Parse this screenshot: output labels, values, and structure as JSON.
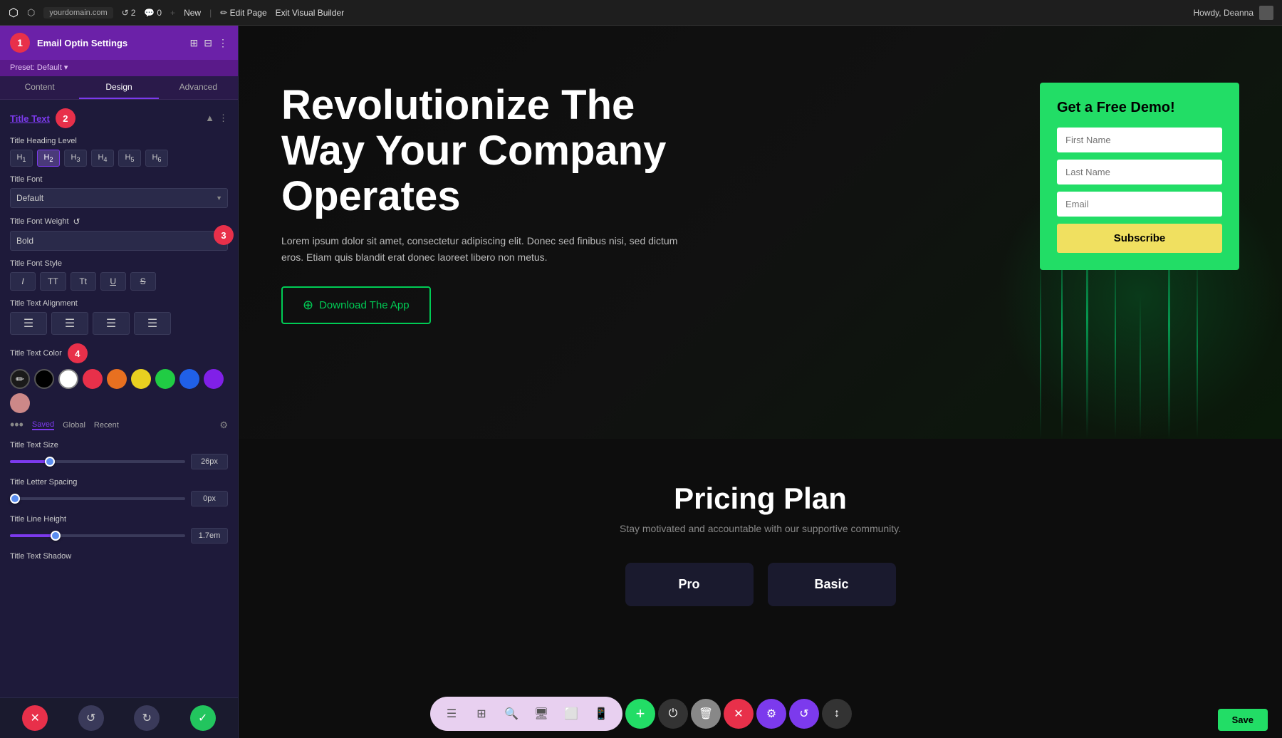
{
  "topbar": {
    "wp_icon": "W",
    "site_icon": "⬡",
    "url": "yourdomain.com",
    "counter_2": "2",
    "counter_0": "0",
    "new_btn": "New",
    "edit_page": "Edit Page",
    "exit_builder": "Exit Visual Builder",
    "howdy": "Howdy, Deanna"
  },
  "left_panel": {
    "title": "Email Optin Settings",
    "preset": "Preset: Default ▾",
    "badge_1": "1",
    "icons": [
      "⊞",
      "⊟",
      "⋮"
    ],
    "tabs": [
      {
        "label": "Content",
        "active": false
      },
      {
        "label": "Design",
        "active": true
      },
      {
        "label": "Advanced",
        "active": false
      }
    ],
    "section": {
      "title": "Title Text",
      "badge": "2",
      "collapse_icon": "▲",
      "more_icon": "⋮"
    },
    "title_heading_level": {
      "label": "Title Heading Level",
      "options": [
        "H₁",
        "H₂",
        "H₃",
        "H₄",
        "H₅",
        "H₆"
      ],
      "active_index": 1
    },
    "title_font": {
      "label": "Title Font",
      "value": "Default"
    },
    "title_font_weight": {
      "label": "Title Font Weight",
      "value": "Bold",
      "badge": "3"
    },
    "title_font_style": {
      "label": "Title Font Style",
      "buttons": [
        "I",
        "TT",
        "Tt",
        "U",
        "S"
      ]
    },
    "title_text_alignment": {
      "label": "Title Text Alignment",
      "buttons": [
        "≡",
        "≡",
        "≡",
        "≡"
      ]
    },
    "title_text_color": {
      "label": "Title Text Color",
      "badge": "4",
      "swatches": [
        {
          "color": "#1a1a1a",
          "type": "pencil"
        },
        {
          "color": "#000000"
        },
        {
          "color": "#ffffff"
        },
        {
          "color": "#e8304a"
        },
        {
          "color": "#e87020"
        },
        {
          "color": "#e8d020"
        },
        {
          "color": "#20cc44"
        },
        {
          "color": "#2060e8"
        },
        {
          "color": "#8020e8"
        },
        {
          "color": "#cc8888"
        }
      ],
      "color_tabs": [
        "Saved",
        "Global",
        "Recent"
      ],
      "active_color_tab": "Saved"
    },
    "title_text_size": {
      "label": "Title Text Size",
      "value": "26px",
      "slider_pct": 22
    },
    "title_letter_spacing": {
      "label": "Title Letter Spacing",
      "value": "0px",
      "slider_pct": 0
    },
    "title_line_height": {
      "label": "Title Line Height",
      "value": "1.7em",
      "slider_pct": 25
    },
    "title_text_shadow": {
      "label": "Title Text Shadow"
    }
  },
  "hero": {
    "title": "Revolutionize The Way Your Company Operates",
    "description": "Lorem ipsum dolor sit amet, consectetur adipiscing elit. Donec sed finibus nisi, sed dictum eros. Etiam quis blandit erat donec laoreet libero non metus.",
    "cta_btn": "Download The App"
  },
  "form": {
    "title": "Get a Free Demo!",
    "first_name_placeholder": "First Name",
    "last_name_placeholder": "Last Name",
    "email_placeholder": "Email",
    "submit_btn": "Subscribe"
  },
  "pricing": {
    "title": "Pricing Plan",
    "subtitle": "Stay motivated and accountable with our supportive community.",
    "pro_label": "Pro",
    "basic_label": "Basic"
  },
  "bottom_toolbar": {
    "group1_icons": [
      "≡",
      "⊞",
      "🔍",
      "◻",
      "◻",
      "◻"
    ],
    "plus_btn": "+",
    "power_btn": "⏻",
    "trash_btn": "🗑",
    "close_btn": "✕",
    "gear_btn": "⚙",
    "undo_btn": "↺",
    "bars_btn": "↕",
    "save_btn": "Save"
  },
  "footer_panel": {
    "close_icon": "✕",
    "undo_icon": "↺",
    "redo_icon": "↻",
    "check_icon": "✓"
  }
}
